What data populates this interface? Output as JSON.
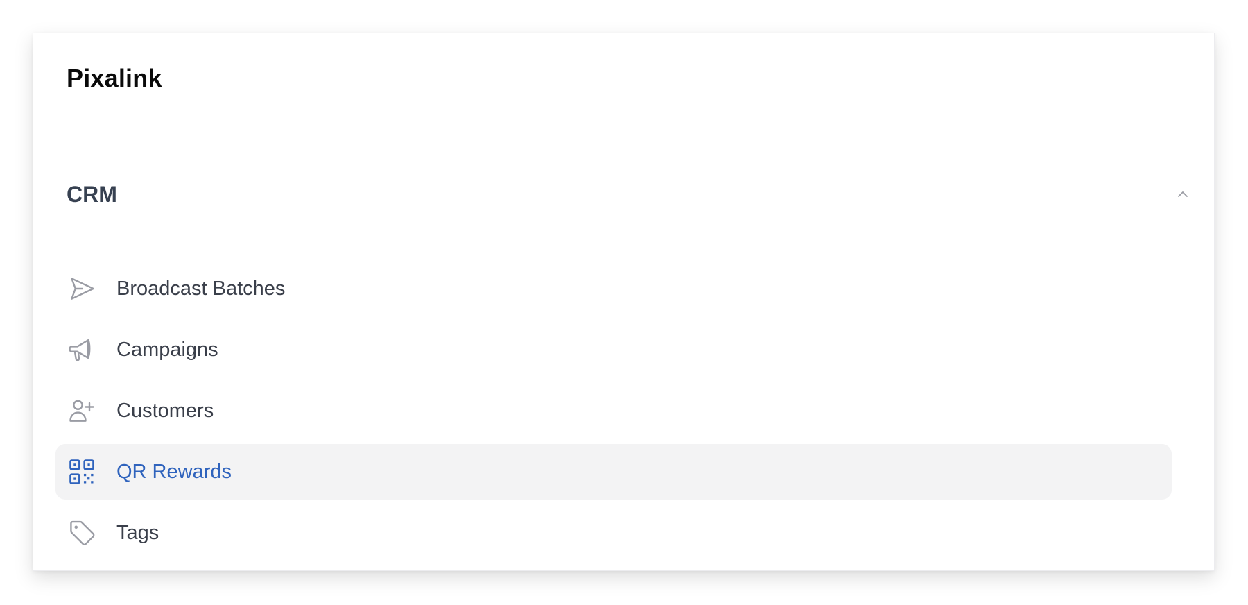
{
  "app": {
    "brand": "Pixalink"
  },
  "sidebar": {
    "group": {
      "label": "CRM",
      "expanded": true,
      "toggle_icon": "chevron-up-icon"
    },
    "items": [
      {
        "label": "Broadcast Batches",
        "icon": "paper-plane-icon",
        "active": false
      },
      {
        "label": "Campaigns",
        "icon": "megaphone-icon",
        "active": false
      },
      {
        "label": "Customers",
        "icon": "user-plus-icon",
        "active": false
      },
      {
        "label": "QR Rewards",
        "icon": "qr-code-icon",
        "active": true
      },
      {
        "label": "Tags",
        "icon": "tag-icon",
        "active": false
      }
    ]
  },
  "colors": {
    "active_text": "#2f63bd",
    "active_background": "#f3f3f4",
    "icon_gray": "#9a9ca4",
    "text": "#3a3f4a"
  }
}
